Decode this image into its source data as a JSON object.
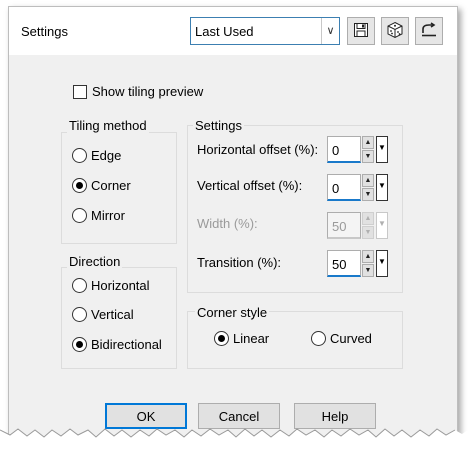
{
  "window": {
    "title": "Settings"
  },
  "toolbar": {
    "preset_value": "Last Used",
    "icons": [
      "save-icon",
      "dice-icon",
      "reset-icon"
    ]
  },
  "options": {
    "show_tiling_preview": "Show tiling preview",
    "show_tiling_preview_checked": false
  },
  "tiling_method": {
    "label": "Tiling method",
    "items": [
      {
        "label": "Edge",
        "selected": false
      },
      {
        "label": "Corner",
        "selected": true
      },
      {
        "label": "Mirror",
        "selected": false
      }
    ]
  },
  "direction": {
    "label": "Direction",
    "items": [
      {
        "label": "Horizontal",
        "selected": false
      },
      {
        "label": "Vertical",
        "selected": false
      },
      {
        "label": "Bidirectional",
        "selected": true
      }
    ]
  },
  "settings": {
    "label": "Settings",
    "horizontal_offset": {
      "label": "Horizontal offset (%):",
      "value": "0"
    },
    "vertical_offset": {
      "label": "Vertical offset (%):",
      "value": "0"
    },
    "width": {
      "label": "Width (%):",
      "value": "50",
      "disabled": true
    },
    "transition": {
      "label": "Transition (%):",
      "value": "50"
    }
  },
  "corner_style": {
    "label": "Corner style",
    "items": [
      {
        "label": "Linear",
        "selected": true
      },
      {
        "label": "Curved",
        "selected": false
      }
    ]
  },
  "buttons": {
    "ok": "OK",
    "cancel": "Cancel",
    "help": "Help"
  },
  "colors": {
    "accent": "#0078d7",
    "panel": "#f0f0f0",
    "focus_underline": "#1979ca"
  }
}
